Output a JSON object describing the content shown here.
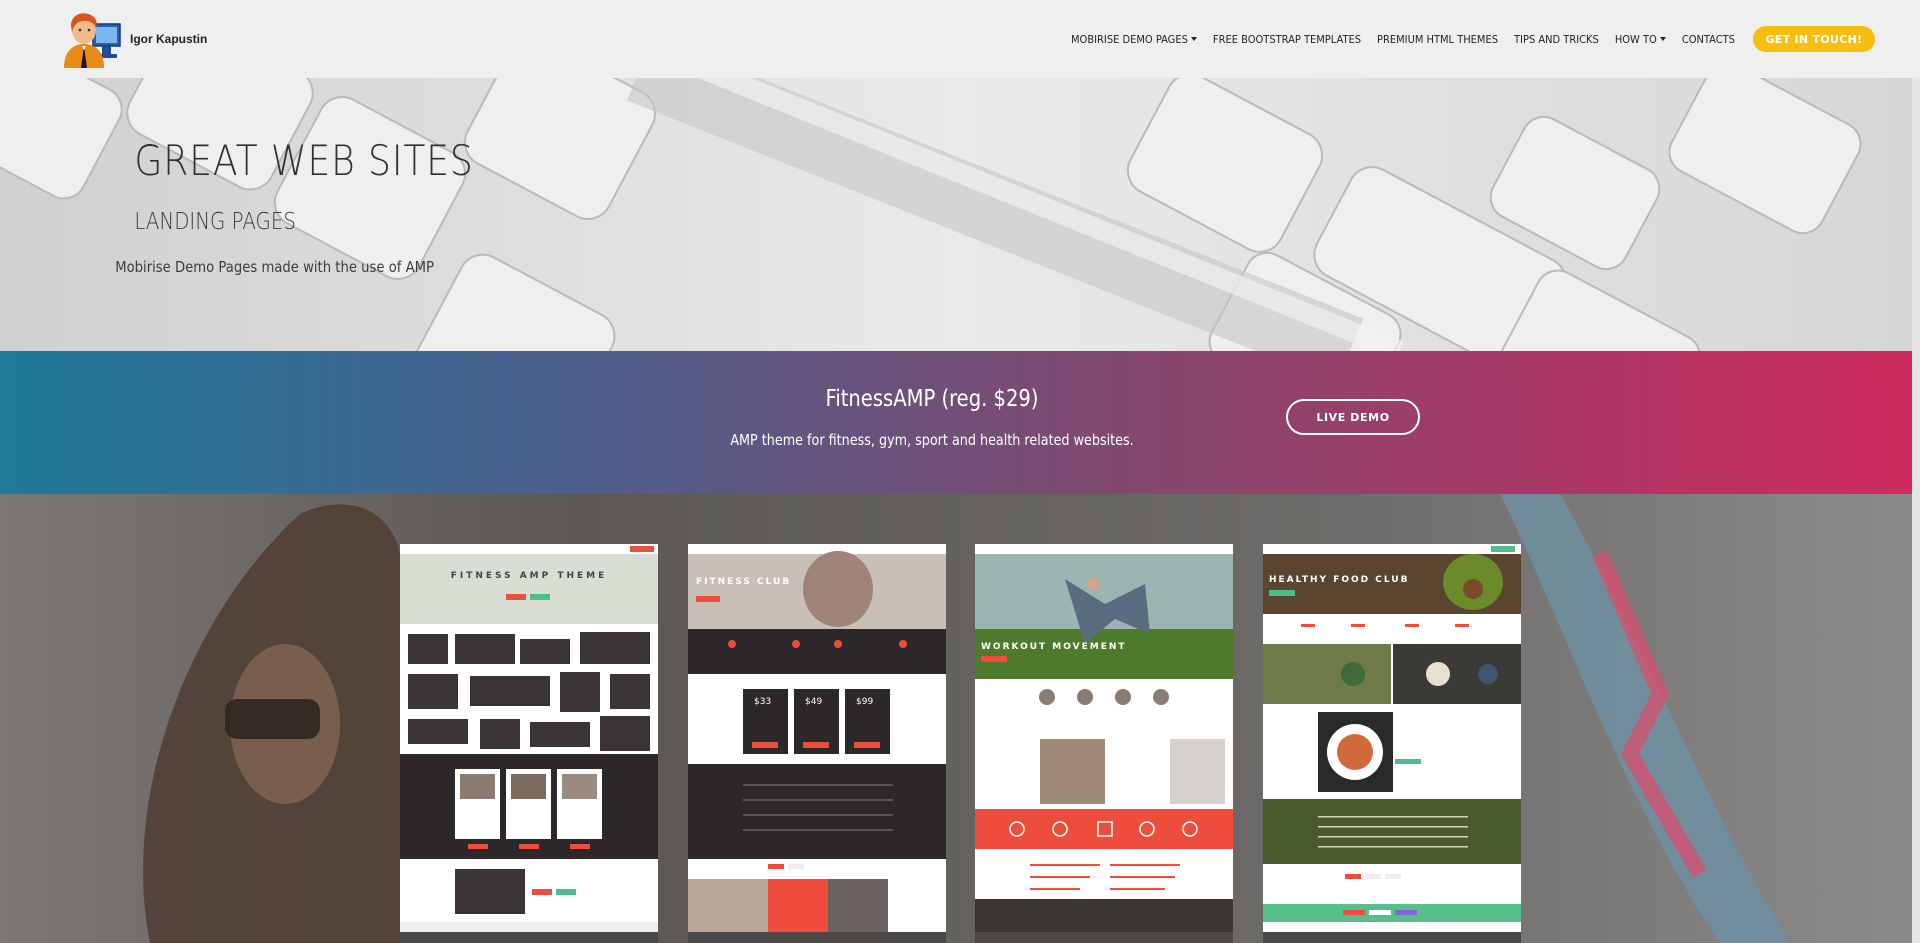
{
  "brand": {
    "name": "Igor Kapustin"
  },
  "nav": {
    "items": [
      {
        "label": "MOBIRISE DEMO PAGES",
        "dropdown": true
      },
      {
        "label": "FREE BOOTSTRAP TEMPLATES",
        "dropdown": false
      },
      {
        "label": "PREMIUM HTML THEMES",
        "dropdown": false
      },
      {
        "label": "TIPS AND TRICKS",
        "dropdown": false
      },
      {
        "label": "HOW TO",
        "dropdown": true
      },
      {
        "label": "CONTACTS",
        "dropdown": false
      }
    ],
    "cta_label": "GET IN TOUCH!"
  },
  "hero": {
    "title": "GREAT WEB SITES",
    "subtitle": "LANDING PAGES",
    "description": "Mobirise Demo Pages made with the use of AMP"
  },
  "banner": {
    "title": "FitnessAMP (reg. $29)",
    "description": "AMP theme for fitness, gym, sport and health related websites.",
    "button_label": "LIVE DEMO"
  },
  "gallery": {
    "cards": [
      {
        "name": "FITNESS AMP THEME"
      },
      {
        "name": "FITNESS CLUB"
      },
      {
        "name": "WORKOUT MOVEMENT"
      },
      {
        "name": "HEALTHY FOOD CLUB"
      }
    ],
    "pricing": [
      "$33",
      "$49",
      "$99"
    ]
  },
  "colors": {
    "accent": "#f7be0f",
    "banner_start": "#1f7a99",
    "banner_end": "#cf2b5e",
    "card_red": "#ef4d3c",
    "card_green": "#4dbd8a"
  }
}
